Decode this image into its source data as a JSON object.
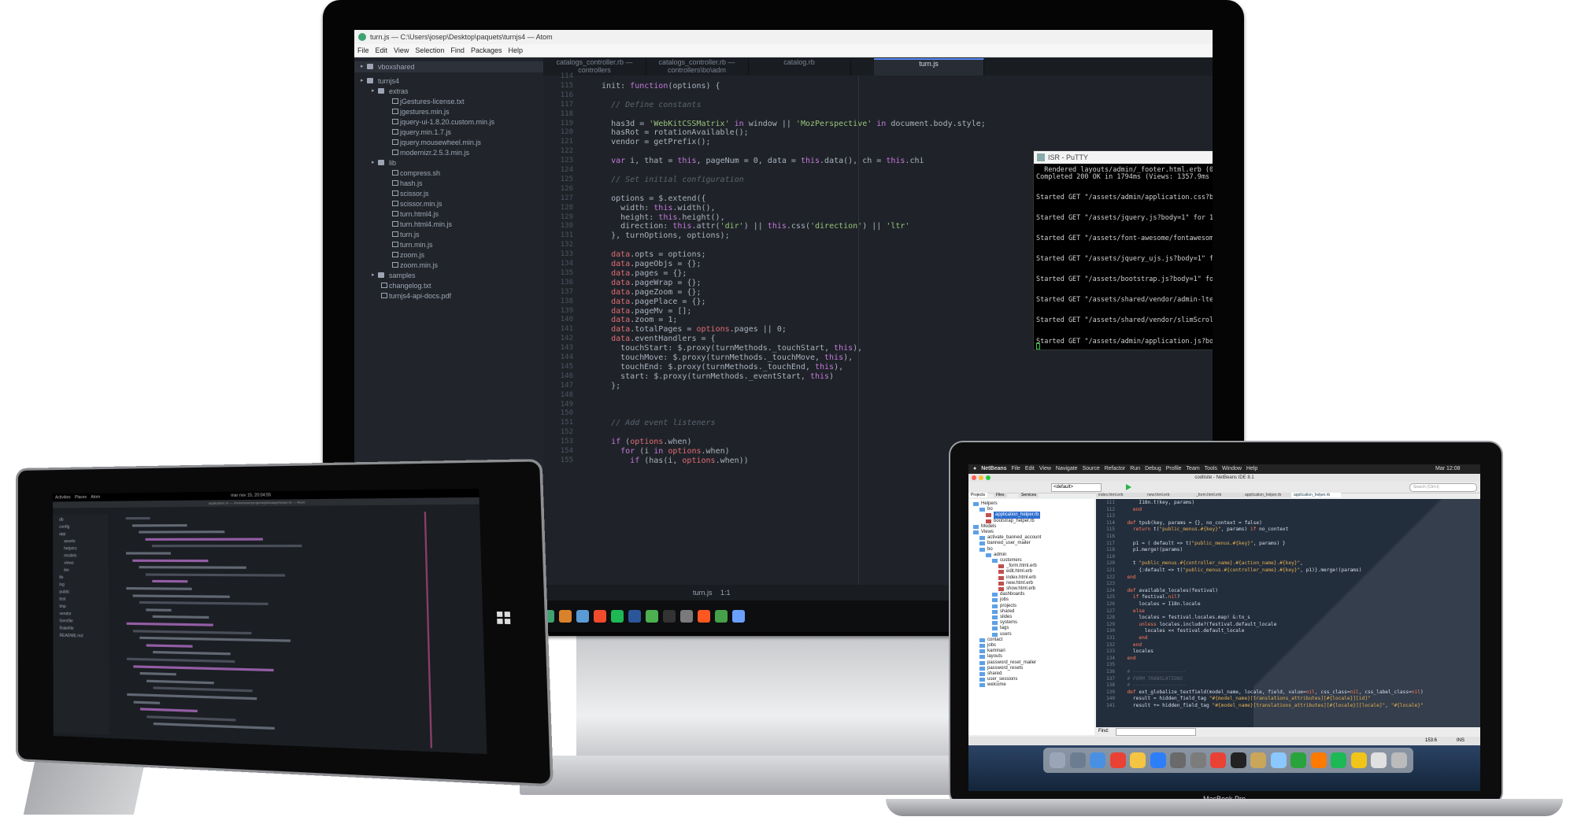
{
  "atom": {
    "title": "turn.js — C:\\Users\\josep\\Desktop\\paquets\\turnjs4 — Atom",
    "menu": [
      "File",
      "Edit",
      "View",
      "Selection",
      "Find",
      "Packages",
      "Help"
    ],
    "tabs": [
      "catalogs_controller.rb — controllers",
      "catalogs_controller.rb — controllers\\bo\\adm",
      "catalog.rb",
      "turn.js"
    ],
    "tree": [
      {
        "label": "vboxshared",
        "kind": "folder",
        "depth": 0
      },
      {
        "label": "turnjs4",
        "kind": "folder",
        "depth": 0
      },
      {
        "label": "extras",
        "kind": "folder",
        "depth": 1
      },
      {
        "label": "jGestures-license.txt",
        "kind": "file",
        "depth": 2
      },
      {
        "label": "jgestures.min.js",
        "kind": "file",
        "depth": 2
      },
      {
        "label": "jquery-ui-1.8.20.custom.min.js",
        "kind": "file",
        "depth": 2
      },
      {
        "label": "jquery.min.1.7.js",
        "kind": "file",
        "depth": 2
      },
      {
        "label": "jquery.mousewheel.min.js",
        "kind": "file",
        "depth": 2
      },
      {
        "label": "modernizr.2.5.3.min.js",
        "kind": "file",
        "depth": 2
      },
      {
        "label": "lib",
        "kind": "folder",
        "depth": 1
      },
      {
        "label": "compress.sh",
        "kind": "file",
        "depth": 2
      },
      {
        "label": "hash.js",
        "kind": "file",
        "depth": 2
      },
      {
        "label": "scissor.js",
        "kind": "file",
        "depth": 2
      },
      {
        "label": "scissor.min.js",
        "kind": "file",
        "depth": 2
      },
      {
        "label": "turn.html4.js",
        "kind": "file",
        "depth": 2
      },
      {
        "label": "turn.html4.min.js",
        "kind": "file",
        "depth": 2
      },
      {
        "label": "turn.js",
        "kind": "file",
        "depth": 2
      },
      {
        "label": "turn.min.js",
        "kind": "file",
        "depth": 2
      },
      {
        "label": "zoom.js",
        "kind": "file",
        "depth": 2
      },
      {
        "label": "zoom.min.js",
        "kind": "file",
        "depth": 2
      },
      {
        "label": "samples",
        "kind": "folder",
        "depth": 1
      },
      {
        "label": "changelog.txt",
        "kind": "file",
        "depth": 1
      },
      {
        "label": "turnjs4-api-docs.pdf",
        "kind": "file",
        "depth": 1
      }
    ],
    "code": [
      {
        "n": "114",
        "t": ""
      },
      {
        "n": "115",
        "t": "  init: function(options) {"
      },
      {
        "n": "116",
        "t": ""
      },
      {
        "n": "117",
        "t": "    // Define constants"
      },
      {
        "n": "118",
        "t": ""
      },
      {
        "n": "119",
        "t": "    has3d = 'WebKitCSSMatrix' in window || 'MozPerspective' in document.body.style;"
      },
      {
        "n": "120",
        "t": "    hasRot = rotationAvailable();"
      },
      {
        "n": "121",
        "t": "    vendor = getPrefix();"
      },
      {
        "n": "122",
        "t": ""
      },
      {
        "n": "123",
        "t": "    var i, that = this, pageNum = 0, data = this.data(), ch = this.chi"
      },
      {
        "n": "124",
        "t": ""
      },
      {
        "n": "125",
        "t": "    // Set initial configuration"
      },
      {
        "n": "126",
        "t": ""
      },
      {
        "n": "127",
        "t": "    options = $.extend({"
      },
      {
        "n": "128",
        "t": "      width: this.width(),"
      },
      {
        "n": "129",
        "t": "      height: this.height(),"
      },
      {
        "n": "130",
        "t": "      direction: this.attr('dir') || this.css('direction') || 'ltr'"
      },
      {
        "n": "131",
        "t": "    }, turnOptions, options);"
      },
      {
        "n": "132",
        "t": ""
      },
      {
        "n": "133",
        "t": "    data.opts = options;"
      },
      {
        "n": "134",
        "t": "    data.pageObjs = {};"
      },
      {
        "n": "135",
        "t": "    data.pages = {};"
      },
      {
        "n": "136",
        "t": "    data.pageWrap = {};"
      },
      {
        "n": "137",
        "t": "    data.pageZoom = {};"
      },
      {
        "n": "138",
        "t": "    data.pagePlace = {};"
      },
      {
        "n": "139",
        "t": "    data.pageMv = [];"
      },
      {
        "n": "140",
        "t": "    data.zoom = 1;"
      },
      {
        "n": "141",
        "t": "    data.totalPages = options.pages || 0;"
      },
      {
        "n": "142",
        "t": "    data.eventHandlers = {"
      },
      {
        "n": "143",
        "t": "      touchStart: $.proxy(turnMethods._touchStart, this),"
      },
      {
        "n": "144",
        "t": "      touchMove: $.proxy(turnMethods._touchMove, this),"
      },
      {
        "n": "145",
        "t": "      touchEnd: $.proxy(turnMethods._touchEnd, this),"
      },
      {
        "n": "146",
        "t": "      start: $.proxy(turnMethods._eventStart, this)"
      },
      {
        "n": "147",
        "t": "    };"
      },
      {
        "n": "148",
        "t": ""
      },
      {
        "n": "149",
        "t": ""
      },
      {
        "n": "150",
        "t": ""
      },
      {
        "n": "151",
        "t": "    // Add event listeners"
      },
      {
        "n": "152",
        "t": ""
      },
      {
        "n": "153",
        "t": "    if (options.when)"
      },
      {
        "n": "154",
        "t": "      for (i in options.when)"
      },
      {
        "n": "155",
        "t": "        if (has(i, options.when))"
      }
    ],
    "status": {
      "file": "turn.js",
      "pos": "1:1"
    }
  },
  "putty": {
    "title": "ISR - PuTTY",
    "lines": [
      "  Rendered layouts/admin/_footer.html.erb (0.1ms)",
      "Completed 200 OK in 1794ms (Views: 1357.9ms | ActiveRecord: 45.0ms)",
      "",
      "",
      "Started GET \"/assets/admin/application.css?body=1\" for 10.0.2.2 at 2016-1",
      "",
      "",
      "Started GET \"/assets/jquery.js?body=1\" for 10.0.2.2 at 2016-11-03 09:4",
      "",
      "",
      "Started GET \"/assets/font-awesome/fontawesome-webfont.woff2\" for 10.0.2.2",
      "",
      "",
      "Started GET \"/assets/jquery_ujs.js?body=1\" for 10.0.2.2 at 2016-11-03 09",
      "",
      "",
      "Started GET \"/assets/bootstrap.js?body=1\" for 10.0.2.2 at 2016-11-03 09:0",
      "",
      "",
      "Started GET \"/assets/shared/vendor/admin-lte/app.js?body=1\" for 10.0.2.2",
      "",
      "",
      "Started GET \"/assets/shared/vendor/slimScroll/jquery.slimscroll.js?body=1",
      "",
      "",
      "Started GET \"/assets/admin/application.js?body=1\" for 10.0.2.2 at 2016-11"
    ]
  },
  "netbeans": {
    "mac_menu": [
      "NetBeans",
      "File",
      "Edit",
      "View",
      "Navigate",
      "Source",
      "Refactor",
      "Run",
      "Debug",
      "Profile",
      "Team",
      "Tools",
      "Window",
      "Help"
    ],
    "clock": "Mar 12:08",
    "window_title": "coditsite - NetBeans IDE 8.1",
    "config": "<default>",
    "search_placeholder": "Search (Ctrl+I)",
    "panel_tabs": [
      "Projects",
      "Files",
      "Services"
    ],
    "editor_tabs": [
      "index.html.erb",
      "new.html.erb",
      "_form.html.erb",
      "application_helper.rb",
      "application_helper.rb"
    ],
    "tree": [
      "Helpers",
      "bo",
      "application_helper.rb",
      "bootstrap_helper.rb",
      "Models",
      "Views",
      "activate_banned_account",
      "banned_user_mailer",
      "bo",
      "admin",
      "customers",
      "_form.html.erb",
      "edit.html.erb",
      "index.html.erb",
      "new.html.erb",
      "show.html.erb",
      "dashboards",
      "jobs",
      "projects",
      "shared",
      "slides",
      "systems",
      "tags",
      "users",
      "contact",
      "jobs",
      "kaminari",
      "layouts",
      "password_reset_mailer",
      "password_resets",
      "shared",
      "user_sessions",
      "welcome"
    ],
    "code": [
      {
        "n": "111",
        "t": "      I18n.t(key, params)"
      },
      {
        "n": "112",
        "t": "    end"
      },
      {
        "n": "113",
        "t": ""
      },
      {
        "n": "114",
        "t": "  def tpub(key, params = {}, no_context = false)"
      },
      {
        "n": "115",
        "t": "    return t(\"public_menus.#{key}\", params) if no_context"
      },
      {
        "n": "116",
        "t": ""
      },
      {
        "n": "117",
        "t": "    p1 = ( default => t(\"public_menus.#{key}\", params) }"
      },
      {
        "n": "118",
        "t": "    p1.merge!(params)"
      },
      {
        "n": "119",
        "t": ""
      },
      {
        "n": "120",
        "t": "    t \"public_menus.#{controller_name}.#{action_name}.#{key}\","
      },
      {
        "n": "121",
        "t": "      {:default => t(\"public_menus.#{controller_name}.#{key}\", p1)}.merge!(params)"
      },
      {
        "n": "122",
        "t": "  end"
      },
      {
        "n": "123",
        "t": ""
      },
      {
        "n": "124",
        "t": "  def available_locales(festival)"
      },
      {
        "n": "125",
        "t": "    if festival.nil?"
      },
      {
        "n": "126",
        "t": "      locales = I18n.locale"
      },
      {
        "n": "127",
        "t": "    else"
      },
      {
        "n": "128",
        "t": "      locales = festival.locales.map! &:to_s"
      },
      {
        "n": "129",
        "t": "      unless locales.include?(festival.default_locale"
      },
      {
        "n": "130",
        "t": "        locales << festival.default_locale"
      },
      {
        "n": "131",
        "t": "      end"
      },
      {
        "n": "132",
        "t": "    end"
      },
      {
        "n": "133",
        "t": "    locales"
      },
      {
        "n": "134",
        "t": "  end"
      },
      {
        "n": "135",
        "t": ""
      },
      {
        "n": "136",
        "t": "  # ------------------"
      },
      {
        "n": "137",
        "t": "  # FORM TRANSLATIONS"
      },
      {
        "n": "138",
        "t": "  # ------------------"
      },
      {
        "n": "139",
        "t": "  def ext_globalize_textfield(model_name, locale, field, value=nil, css_class=nil, css_label_class=nil)"
      },
      {
        "n": "140",
        "t": "    result = hidden_field_tag \"#{model_name}[translations_attributes][#{locale}][id]\""
      },
      {
        "n": "141",
        "t": "    result += hidden_field_tag \"#{model_name}[translations_attributes][#{locale}][locale]\", \"#{locale}\""
      }
    ],
    "find_label": "Find:",
    "cursor_pos": "153:6",
    "insert_mode": "INS",
    "device_label": "MacBook Pro"
  },
  "tablet": {
    "top_menu": [
      "Activities",
      "Places",
      "Atom"
    ],
    "clock": "mar nov 15, 20:04:55",
    "window_title": "application.rb — /home/user/projects/jobs/app/helper.rb — Atom",
    "tree": [
      "db",
      "config",
      "app",
      "assets",
      "helpers",
      "models",
      "views",
      "bin",
      "lib",
      "log",
      "public",
      "test",
      "tmp",
      "vendor",
      "Gemfile",
      "Rakefile",
      "README.md"
    ]
  },
  "colors": {
    "accent": "#568af2",
    "atom_bg": "#1f2329",
    "keyword": "#c678dd",
    "string": "#98c379",
    "comment": "#5c6370",
    "func": "#61afef",
    "prop": "#e06c75"
  }
}
